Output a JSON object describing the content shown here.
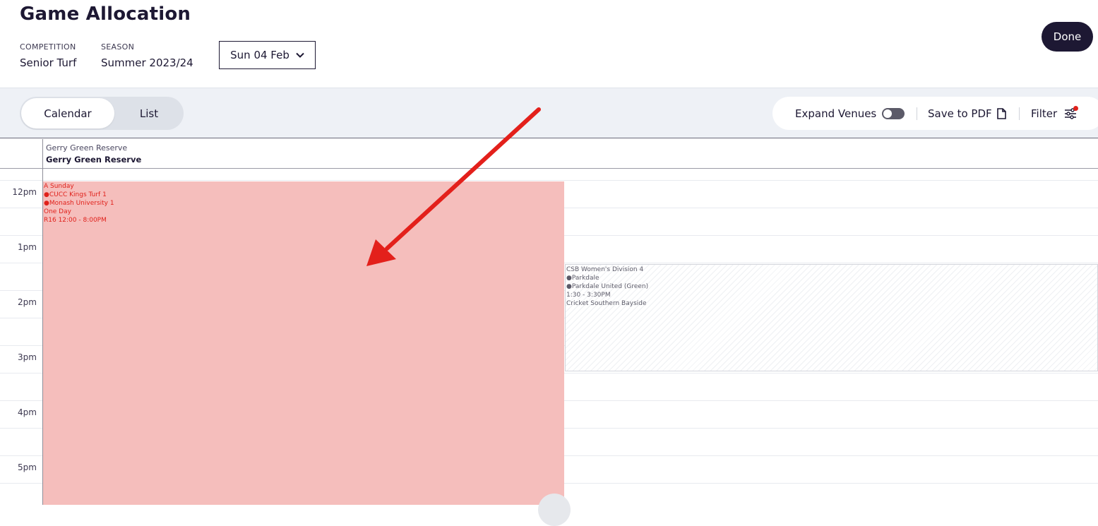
{
  "header": {
    "title": "Game Allocation",
    "competition_label": "COMPETITION",
    "competition_value": "Senior Turf",
    "season_label": "SEASON",
    "season_value": "Summer 2023/24",
    "date": "Sun 04 Feb",
    "done_label": "Done"
  },
  "toolbar": {
    "view_tabs": [
      {
        "label": "Calendar",
        "active": true
      },
      {
        "label": "List",
        "active": false
      }
    ],
    "expand_venues_label": "Expand Venues",
    "expand_venues_on": false,
    "save_pdf_label": "Save to PDF",
    "filter_label": "Filter",
    "filter_active_color": "#e0211b"
  },
  "calendar": {
    "venue_subtitle": "Gerry Green Reserve",
    "venue_name": "Gerry Green Reserve",
    "times": [
      "12pm",
      "1pm",
      "2pm",
      "3pm",
      "4pm",
      "5pm"
    ],
    "events": [
      {
        "lines": [
          "A Sunday",
          "●CUCC Kings Turf 1",
          "●Monash University 1",
          "One Day",
          "R16   12:00 - 8:00PM"
        ],
        "color": "#e0211b",
        "background": "#f5bebc"
      },
      {
        "lines": [
          "CSB Women's Division 4",
          "●Parkdale",
          "●Parkdale United (Green)",
          "1:30 - 3:30PM",
          "Cricket Southern Bayside"
        ],
        "color": "#5b5a68"
      }
    ]
  },
  "annotation": {
    "arrow_color": "#e3201b"
  },
  "colors": {
    "primary": "#1d1833",
    "toolbar_bg": "#eef1f6"
  }
}
